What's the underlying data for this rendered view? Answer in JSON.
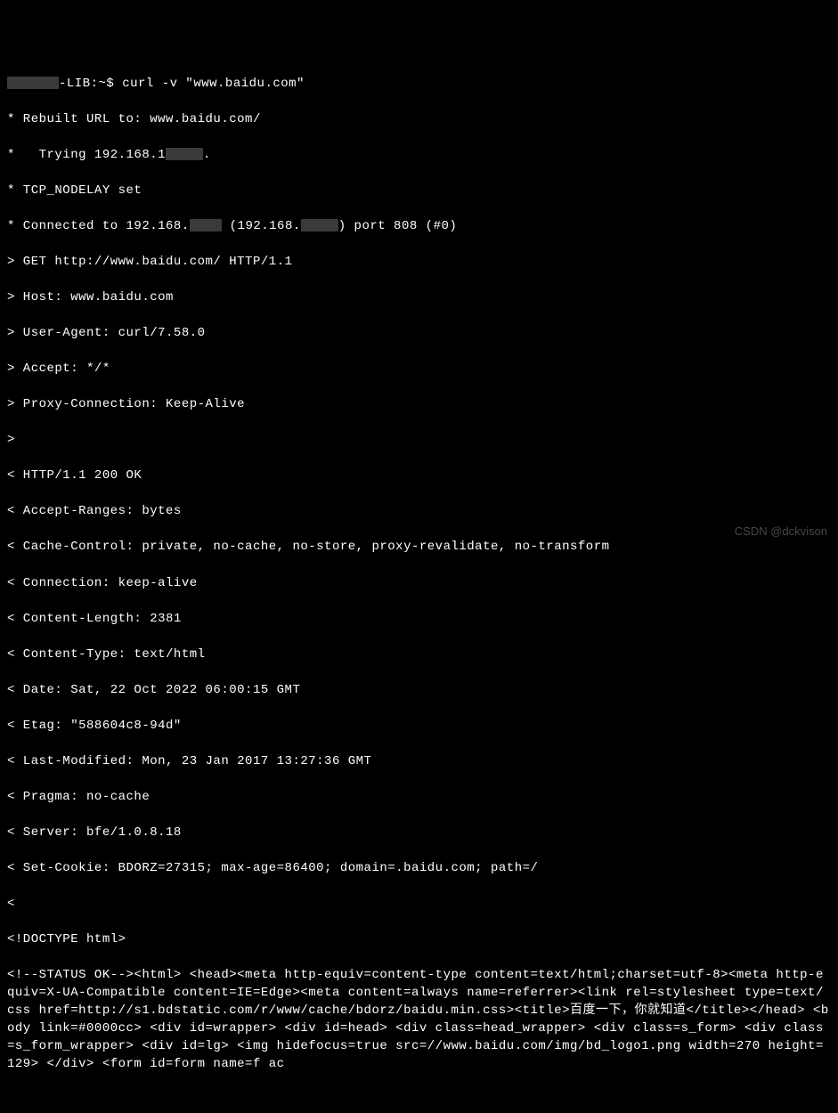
{
  "prompt": {
    "host_suffix": "-LIB:~$ ",
    "command": "curl -v \"www.baidu.com\""
  },
  "redact_widths": {
    "host_prefix": "58px",
    "ip_suffix_1": "42px",
    "ip_suffix_2": "36px",
    "ip_suffix_3": "42px"
  },
  "verbose": {
    "rebuilt": "* Rebuilt URL to: www.baidu.com/",
    "trying_prefix": "*   Trying 192.168.1",
    "trying_suffix": ".",
    "nodelay": "* TCP_NODELAY set",
    "connected_prefix": "* Connected to 192.168.",
    "connected_mid": " (192.168.",
    "connected_suffix": ") port 808 (#0)"
  },
  "request": {
    "get": "> GET http://www.baidu.com/ HTTP/1.1",
    "host": "> Host: www.baidu.com",
    "ua": "> User-Agent: curl/7.58.0",
    "accept": "> Accept: */*",
    "proxy": "> Proxy-Connection: Keep-Alive",
    "end": ">"
  },
  "response": {
    "status": "< HTTP/1.1 200 OK",
    "accept_ranges": "< Accept-Ranges: bytes",
    "cache_control": "< Cache-Control: private, no-cache, no-store, proxy-revalidate, no-transform",
    "connection": "< Connection: keep-alive",
    "content_length": "< Content-Length: 2381",
    "content_type": "< Content-Type: text/html",
    "date": "< Date: Sat, 22 Oct 2022 06:00:15 GMT",
    "etag": "< Etag: \"588604c8-94d\"",
    "last_modified": "< Last-Modified: Mon, 23 Jan 2017 13:27:36 GMT",
    "pragma": "< Pragma: no-cache",
    "server": "< Server: bfe/1.0.8.18",
    "set_cookie": "< Set-Cookie: BDORZ=27315; max-age=86400; domain=.baidu.com; path=/",
    "end": "<"
  },
  "body": {
    "doctype": "<!DOCTYPE html>",
    "content": "<!--STATUS OK--><html> <head><meta http-equiv=content-type content=text/html;charset=utf-8><meta http-equiv=X-UA-Compatible content=IE=Edge><meta content=always name=referrer><link rel=stylesheet type=text/css href=http://s1.bdstatic.com/r/www/cache/bdorz/baidu.min.css><title>百度一下，你就知道</title></head> <body link=#0000cc> <div id=wrapper> <div id=head> <div class=head_wrapper> <div class=s_form> <div class=s_form_wrapper> <div id=lg> <img hidefocus=true src=//www.baidu.com/img/bd_logo1.png width=270 height=129> </div> <form id=form name=f ac"
  },
  "watermark": "CSDN @dckvison"
}
